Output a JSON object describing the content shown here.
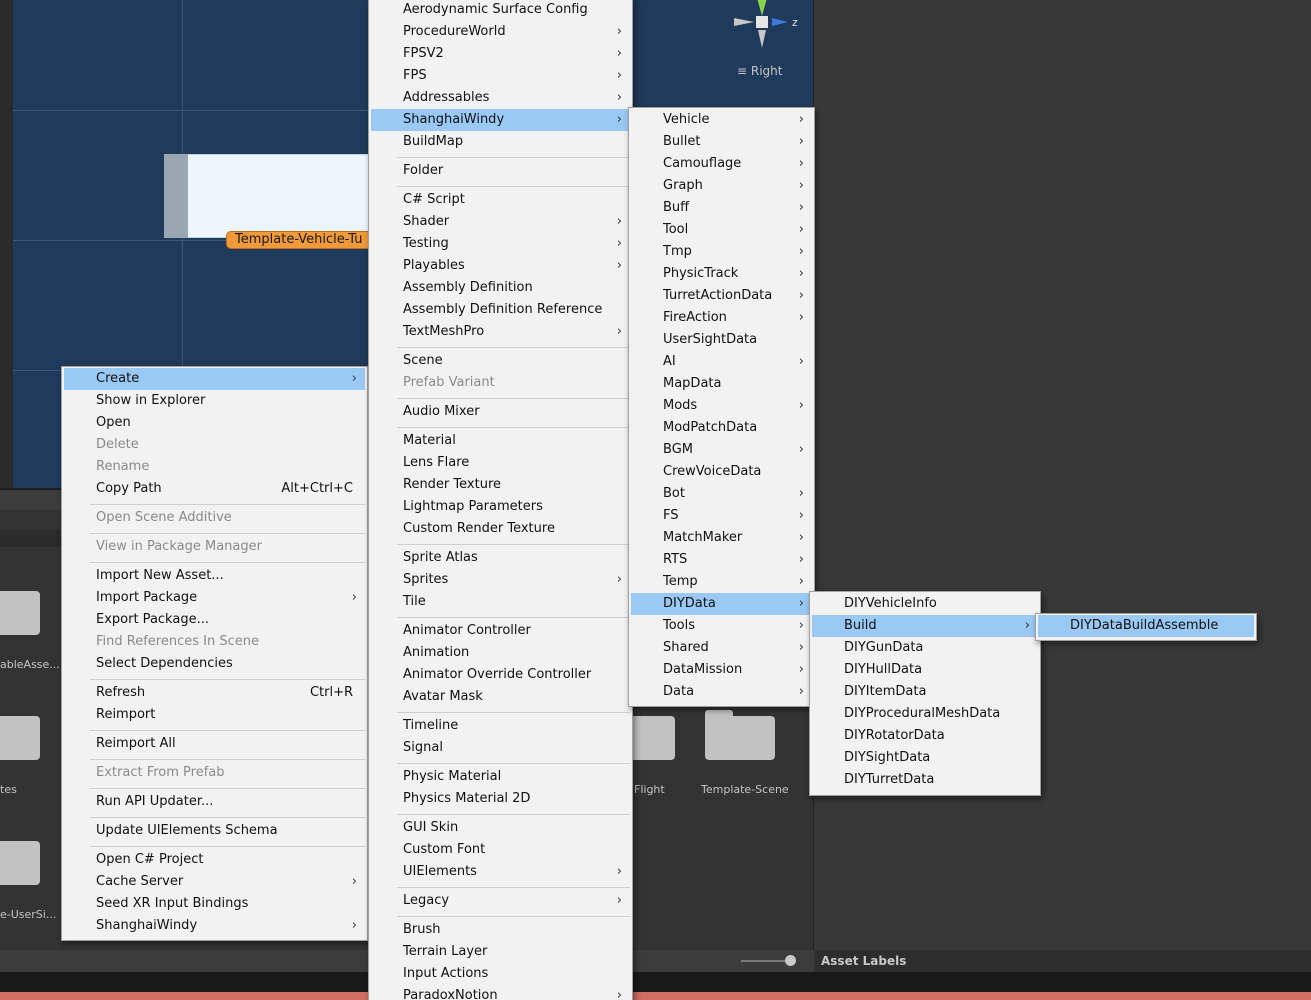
{
  "scene": {
    "prefab_label": "Template-Vehicle-Tu",
    "gizmo_label": "≡ Right",
    "gizmo_axis": "z"
  },
  "project_panel": {
    "folders": [
      {
        "label": "ableAsse..."
      },
      {
        "label": "tes"
      },
      {
        "label": "e-UserSi..."
      },
      {
        "label": "Flight"
      },
      {
        "label": "Template-Scene"
      }
    ]
  },
  "inspector": {
    "asset_labels": "Asset Labels"
  },
  "context_menu": {
    "items": [
      {
        "label": "Create",
        "submenu": true,
        "highlighted": true
      },
      {
        "label": "Show in Explorer"
      },
      {
        "label": "Open"
      },
      {
        "label": "Delete",
        "disabled": true
      },
      {
        "label": "Rename",
        "disabled": true
      },
      {
        "label": "Copy Path",
        "shortcut": "Alt+Ctrl+C"
      },
      {
        "label": "Open Scene Additive",
        "disabled": true
      },
      {
        "label": "View in Package Manager",
        "disabled": true
      },
      {
        "label": "Import New Asset..."
      },
      {
        "label": "Import Package",
        "submenu": true
      },
      {
        "label": "Export Package..."
      },
      {
        "label": "Find References In Scene",
        "disabled": true
      },
      {
        "label": "Select Dependencies"
      },
      {
        "label": "Refresh",
        "shortcut": "Ctrl+R"
      },
      {
        "label": "Reimport"
      },
      {
        "label": "Reimport All"
      },
      {
        "label": "Extract From Prefab",
        "disabled": true
      },
      {
        "label": "Run API Updater..."
      },
      {
        "label": "Update UIElements Schema"
      },
      {
        "label": "Open C# Project"
      },
      {
        "label": "Cache Server",
        "submenu": true
      },
      {
        "label": "Seed XR Input Bindings"
      },
      {
        "label": "ShanghaiWindy",
        "submenu": true
      }
    ]
  },
  "create_menu": {
    "items": [
      {
        "label": "Aerodynamic Surface Config"
      },
      {
        "label": "ProcedureWorld",
        "submenu": true
      },
      {
        "label": "FPSV2",
        "submenu": true
      },
      {
        "label": "FPS",
        "submenu": true
      },
      {
        "label": "Addressables",
        "submenu": true
      },
      {
        "label": "ShanghaiWindy",
        "submenu": true,
        "highlighted": true
      },
      {
        "label": "BuildMap"
      },
      {
        "label": "Folder"
      },
      {
        "label": "C# Script"
      },
      {
        "label": "Shader",
        "submenu": true
      },
      {
        "label": "Testing",
        "submenu": true
      },
      {
        "label": "Playables",
        "submenu": true
      },
      {
        "label": "Assembly Definition"
      },
      {
        "label": "Assembly Definition Reference"
      },
      {
        "label": "TextMeshPro",
        "submenu": true
      },
      {
        "label": "Scene"
      },
      {
        "label": "Prefab Variant",
        "disabled": true
      },
      {
        "label": "Audio Mixer"
      },
      {
        "label": "Material"
      },
      {
        "label": "Lens Flare"
      },
      {
        "label": "Render Texture"
      },
      {
        "label": "Lightmap Parameters"
      },
      {
        "label": "Custom Render Texture"
      },
      {
        "label": "Sprite Atlas"
      },
      {
        "label": "Sprites",
        "submenu": true
      },
      {
        "label": "Tile"
      },
      {
        "label": "Animator Controller"
      },
      {
        "label": "Animation"
      },
      {
        "label": "Animator Override Controller"
      },
      {
        "label": "Avatar Mask"
      },
      {
        "label": "Timeline"
      },
      {
        "label": "Signal"
      },
      {
        "label": "Physic Material"
      },
      {
        "label": "Physics Material 2D"
      },
      {
        "label": "GUI Skin"
      },
      {
        "label": "Custom Font"
      },
      {
        "label": "UIElements",
        "submenu": true
      },
      {
        "label": "Legacy",
        "submenu": true
      },
      {
        "label": "Brush"
      },
      {
        "label": "Terrain Layer"
      },
      {
        "label": "Input Actions"
      },
      {
        "label": "ParadoxNotion",
        "submenu": true
      }
    ]
  },
  "shanghaiwindy_menu": {
    "items": [
      {
        "label": "Vehicle",
        "submenu": true
      },
      {
        "label": "Bullet",
        "submenu": true
      },
      {
        "label": "Camouflage",
        "submenu": true
      },
      {
        "label": "Graph",
        "submenu": true
      },
      {
        "label": "Buff",
        "submenu": true
      },
      {
        "label": "Tool",
        "submenu": true
      },
      {
        "label": "Tmp",
        "submenu": true
      },
      {
        "label": "PhysicTrack",
        "submenu": true
      },
      {
        "label": "TurretActionData",
        "submenu": true
      },
      {
        "label": "FireAction",
        "submenu": true
      },
      {
        "label": "UserSightData"
      },
      {
        "label": "AI",
        "submenu": true
      },
      {
        "label": "MapData"
      },
      {
        "label": "Mods",
        "submenu": true
      },
      {
        "label": "ModPatchData"
      },
      {
        "label": "BGM",
        "submenu": true
      },
      {
        "label": "CrewVoiceData"
      },
      {
        "label": "Bot",
        "submenu": true
      },
      {
        "label": "FS",
        "submenu": true
      },
      {
        "label": "MatchMaker",
        "submenu": true
      },
      {
        "label": "RTS",
        "submenu": true
      },
      {
        "label": "Temp",
        "submenu": true
      },
      {
        "label": "DIYData",
        "submenu": true,
        "highlighted": true
      },
      {
        "label": "Tools",
        "submenu": true
      },
      {
        "label": "Shared",
        "submenu": true
      },
      {
        "label": "DataMission",
        "submenu": true
      },
      {
        "label": "Data",
        "submenu": true
      }
    ]
  },
  "diydata_menu": {
    "items": [
      {
        "label": "DIYVehicleInfo"
      },
      {
        "label": "Build",
        "submenu": true,
        "highlighted": true
      },
      {
        "label": "DIYGunData"
      },
      {
        "label": "DIYHullData"
      },
      {
        "label": "DIYItemData"
      },
      {
        "label": "DIYProceduralMeshData"
      },
      {
        "label": "DIYRotatorData"
      },
      {
        "label": "DIYSightData"
      },
      {
        "label": "DIYTurretData"
      }
    ]
  },
  "build_menu": {
    "items": [
      {
        "label": "DIYDataBuildAssemble",
        "highlighted": true
      }
    ]
  },
  "arrow_glyph": "›",
  "colors": {
    "menu_bg": "#f2f2f2",
    "highlight": "#99c9f4",
    "scene_bg": "#1f3a5a",
    "prefab_label": "#f19a3b"
  }
}
